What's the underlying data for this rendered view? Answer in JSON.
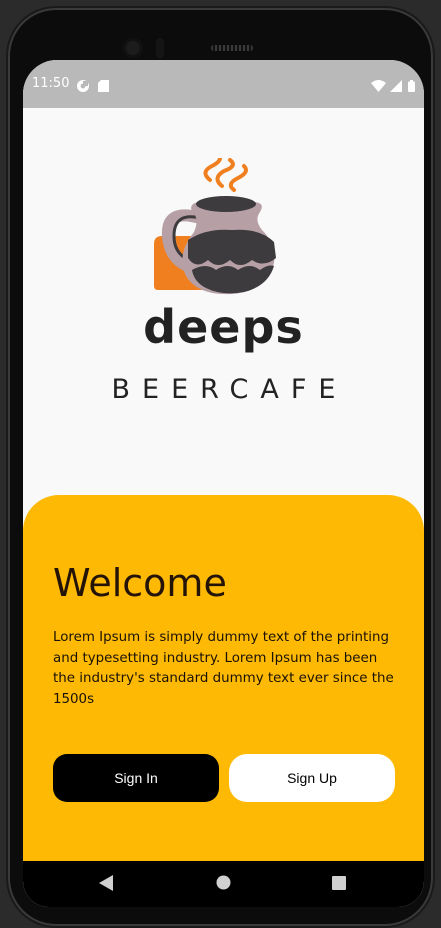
{
  "status": {
    "time": "11:50"
  },
  "brand": {
    "name": "deeps",
    "tagline": "BEERCAFE"
  },
  "welcome": {
    "title": "Welcome",
    "description": "Lorem Ipsum is simply dummy text of the printing and typesetting industry. Lorem Ipsum has been the industry's standard dummy text ever since the 1500s"
  },
  "buttons": {
    "signin": "Sign In",
    "signup": "Sign Up"
  },
  "colors": {
    "accent": "#fdb903",
    "logo_orange": "#f0801f",
    "logo_jug": "#b79fa6",
    "logo_dark": "#3d3b3e",
    "status_bar": "#b9b9b9"
  },
  "icons": [
    "wifi-icon",
    "signal-icon",
    "battery-icon",
    "back-icon",
    "home-icon",
    "recents-icon"
  ]
}
